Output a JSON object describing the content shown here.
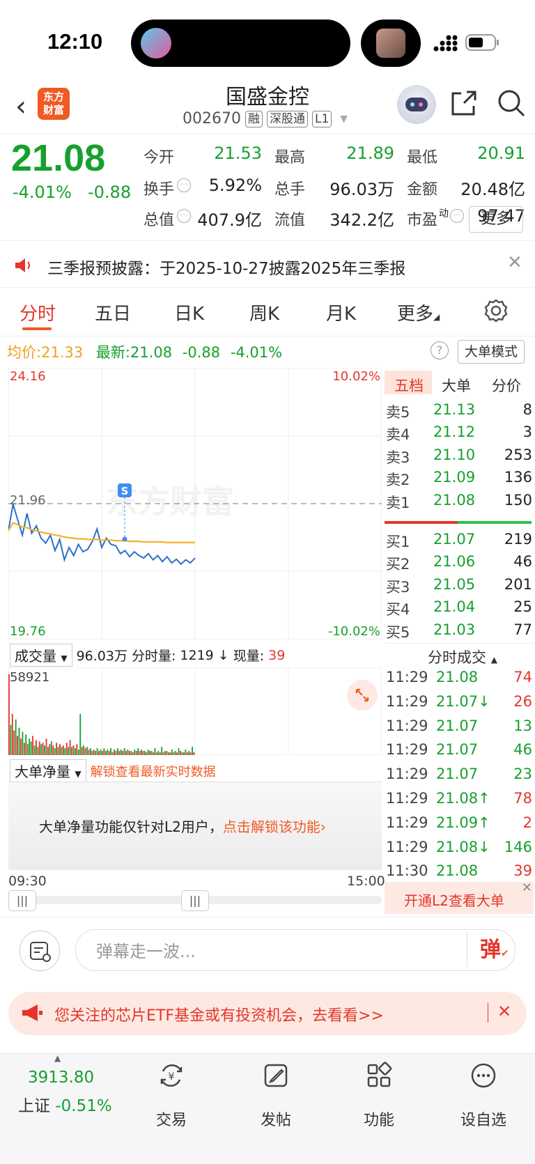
{
  "status": {
    "time": "12:10"
  },
  "header": {
    "logo_line1": "东方",
    "logo_line2": "财富",
    "title": "国盛金控",
    "code": "002670",
    "tags": [
      "融",
      "深股通",
      "L1"
    ]
  },
  "quote": {
    "price": "21.08",
    "pct": "-4.01%",
    "change": "-0.88",
    "fields": [
      {
        "label": "今开",
        "value": "21.53",
        "color": "green"
      },
      {
        "label": "最高",
        "value": "21.89",
        "color": "green"
      },
      {
        "label": "最低",
        "value": "20.91",
        "color": "green"
      },
      {
        "label": "换手",
        "value": "5.92%",
        "color": "dark"
      },
      {
        "label": "总手",
        "value": "96.03万",
        "color": "dark"
      },
      {
        "label": "金额",
        "value": "20.48亿",
        "color": "dark"
      },
      {
        "label": "总值",
        "value": "407.9亿",
        "color": "dark"
      },
      {
        "label": "流值",
        "value": "342.2亿",
        "color": "dark"
      },
      {
        "label": "市盈",
        "label_sup": "动",
        "value": "97.47",
        "color": "dark"
      }
    ],
    "more_label": "更多"
  },
  "notice": {
    "text": "三季报预披露：于2025-10-27披露2025年三季报"
  },
  "tabs": [
    "分时",
    "五日",
    "日K",
    "周K",
    "月K",
    "更多"
  ],
  "avg_row": {
    "avg_label": "均价:",
    "avg_value": "21.33",
    "latest_label": "最新:",
    "latest_value": "21.08",
    "latest_change": "-0.88",
    "latest_pct": "-4.01%",
    "mode_btn": "大单模式"
  },
  "chart_labels": {
    "y_top": "24.16",
    "y_mid": "21.96",
    "y_bottom": "19.76",
    "pct_top": "10.02%",
    "pct_bottom": "-10.02%",
    "watermark": "东方财富",
    "marker": "S",
    "x_start": "09:30",
    "x_end": "15:00"
  },
  "colors": {
    "up": "#e5352b",
    "down": "#16a02e",
    "price_line": "#2b6fc9",
    "avg_line": "#f5b02a",
    "accent": "#f05a24"
  },
  "chart_data": {
    "type": "line",
    "title": "",
    "xlabel": "",
    "ylabel": "",
    "ylim": [
      19.76,
      24.16
    ],
    "reference": 21.96,
    "x_range": [
      "09:30",
      "15:00"
    ],
    "x": [
      "09:30",
      "09:33",
      "09:36",
      "09:39",
      "09:42",
      "09:45",
      "09:48",
      "09:51",
      "09:54",
      "09:57",
      "10:00",
      "10:03",
      "10:06",
      "10:09",
      "10:12",
      "10:15",
      "10:18",
      "10:21",
      "10:24",
      "10:27",
      "10:30",
      "10:33",
      "10:36",
      "10:39",
      "10:42",
      "10:45",
      "10:48",
      "10:51",
      "10:54",
      "10:57",
      "11:00",
      "11:03",
      "11:06",
      "11:09",
      "11:12",
      "11:15",
      "11:18",
      "11:21",
      "11:24",
      "11:27",
      "11:30"
    ],
    "series": [
      {
        "values": [
          21.52,
          21.95,
          21.7,
          21.45,
          21.8,
          21.48,
          21.6,
          21.4,
          21.32,
          21.45,
          21.2,
          21.38,
          21.05,
          21.25,
          21.12,
          21.3,
          21.18,
          21.22,
          21.35,
          21.55,
          21.25,
          21.4,
          21.3,
          21.28,
          21.15,
          21.2,
          21.1,
          21.18,
          21.12,
          21.08,
          21.15,
          21.05,
          21.12,
          21.02,
          21.1,
          21.0,
          21.06,
          20.98,
          21.05,
          21.0,
          21.08
        ]
      },
      {
        "values": [
          21.52,
          21.65,
          21.62,
          21.58,
          21.57,
          21.54,
          21.52,
          21.5,
          21.48,
          21.47,
          21.45,
          21.44,
          21.42,
          21.41,
          21.4,
          21.39,
          21.39,
          21.38,
          21.38,
          21.38,
          21.37,
          21.37,
          21.37,
          21.36,
          21.36,
          21.36,
          21.35,
          21.35,
          21.35,
          21.34,
          21.34,
          21.34,
          21.34,
          21.34,
          21.33,
          21.33,
          21.33,
          21.33,
          21.33,
          21.33,
          21.33
        ]
      }
    ],
    "volume": {
      "max_label": "58921",
      "bars": [
        58921,
        22000,
        30000,
        18000,
        26000,
        14000,
        20000,
        12000,
        17000,
        9000,
        15000,
        8000,
        12000,
        10000,
        14000,
        7000,
        11000,
        6000,
        10000,
        8000,
        9000,
        7000,
        12000,
        6000,
        8000,
        10000,
        7000,
        5000,
        9000,
        6000,
        8000,
        6000,
        7000,
        5000,
        9000,
        6000,
        11000,
        6000,
        7000,
        5000,
        8000,
        4000,
        30000,
        6000,
        7000,
        5000,
        6000,
        4000,
        5000,
        3000,
        4000,
        3000,
        5000,
        3000,
        4000,
        3000,
        5000,
        3000,
        4000,
        3000,
        5000,
        2000,
        4000,
        3000,
        5000,
        3000,
        4000,
        3000,
        5000,
        3000,
        4000,
        3000,
        3000,
        2000,
        4000,
        3000,
        5000,
        3000,
        4000,
        3000,
        3000,
        2000,
        4000,
        3000,
        3000,
        2000,
        5000,
        2000,
        3000,
        2000,
        6000,
        2000,
        3000,
        3000,
        2000,
        2000,
        4000,
        2000,
        3000,
        2000,
        5000,
        3000,
        2000,
        2000,
        4000,
        2000,
        3000,
        2000,
        6000,
        2000
      ],
      "directions": [
        "u",
        "d",
        "u",
        "u",
        "d",
        "u",
        "d",
        "u",
        "d",
        "u",
        "d",
        "u",
        "d",
        "d",
        "u",
        "d",
        "u",
        "d",
        "u",
        "d",
        "u",
        "d",
        "u",
        "d",
        "u",
        "d",
        "u",
        "d",
        "u",
        "d",
        "u",
        "d",
        "u",
        "d",
        "u",
        "d",
        "u",
        "d",
        "u",
        "d",
        "u",
        "d",
        "d",
        "u",
        "d",
        "u",
        "d",
        "u",
        "d",
        "u",
        "d",
        "u",
        "d",
        "u",
        "d",
        "u",
        "d",
        "u",
        "d",
        "u",
        "d",
        "u",
        "d",
        "u",
        "d",
        "u",
        "d",
        "u",
        "d",
        "u",
        "d",
        "u",
        "d",
        "u",
        "d",
        "u",
        "d",
        "u",
        "d",
        "u",
        "d",
        "u",
        "d",
        "u",
        "d",
        "u",
        "d",
        "u",
        "d",
        "u",
        "d",
        "u",
        "d",
        "u",
        "d",
        "u",
        "d",
        "u",
        "d",
        "u",
        "d",
        "u",
        "d",
        "u",
        "d",
        "u",
        "d",
        "u",
        "d",
        "u"
      ]
    }
  },
  "order_book": {
    "tabs": [
      "五档",
      "大单",
      "分价"
    ],
    "asks": [
      {
        "label": "卖5",
        "price": "21.13",
        "vol": "8"
      },
      {
        "label": "卖4",
        "price": "21.12",
        "vol": "3"
      },
      {
        "label": "卖3",
        "price": "21.10",
        "vol": "253"
      },
      {
        "label": "卖2",
        "price": "21.09",
        "vol": "136"
      },
      {
        "label": "卖1",
        "price": "21.08",
        "vol": "150"
      }
    ],
    "bids": [
      {
        "label": "买1",
        "price": "21.07",
        "vol": "219"
      },
      {
        "label": "买2",
        "price": "21.06",
        "vol": "46"
      },
      {
        "label": "买3",
        "price": "21.05",
        "vol": "201"
      },
      {
        "label": "买4",
        "price": "21.04",
        "vol": "25"
      },
      {
        "label": "买5",
        "price": "21.03",
        "vol": "77"
      }
    ],
    "ticks_title": "分时成交",
    "ticks": [
      {
        "time": "11:29",
        "price": "21.08",
        "vol": "74",
        "dir": "u"
      },
      {
        "time": "11:29",
        "price": "21.07↓",
        "vol": "26",
        "dir": "u"
      },
      {
        "time": "11:29",
        "price": "21.07",
        "vol": "13",
        "dir": "d"
      },
      {
        "time": "11:29",
        "price": "21.07",
        "vol": "46",
        "dir": "d"
      },
      {
        "time": "11:29",
        "price": "21.07",
        "vol": "23",
        "dir": "d"
      },
      {
        "time": "11:29",
        "price": "21.08↑",
        "vol": "78",
        "dir": "u"
      },
      {
        "time": "11:29",
        "price": "21.09↑",
        "vol": "2",
        "dir": "u"
      },
      {
        "time": "11:29",
        "price": "21.08↓",
        "vol": "146",
        "dir": "d"
      },
      {
        "time": "11:30",
        "price": "21.08",
        "vol": "39",
        "dir": "u"
      }
    ],
    "l2_btn": "开通L2查看大单"
  },
  "volume_header": {
    "select": "成交量",
    "total": "96.03万",
    "period_label": "分时量:",
    "period_value": "1219 ↓",
    "now_label": "现量:",
    "now_value": "39"
  },
  "bigorder": {
    "select": "大单净量",
    "unlock_text": "解锁查看最新实时数据",
    "panel_text": "大单净量功能仅针对L2用户，",
    "panel_link": "点击解锁该功能›"
  },
  "comment": {
    "placeholder": "弹幕走一波...",
    "btn": "弹"
  },
  "promo": {
    "text": "您关注的芯片ETF基金或有投资机会，去看看>>"
  },
  "bottom_nav": {
    "index_value": "3913.80",
    "index_name": "上证",
    "index_pct": "-0.51%",
    "items": [
      {
        "label": "交易",
        "icon": "yen-exchange-icon"
      },
      {
        "label": "发帖",
        "icon": "edit-icon"
      },
      {
        "label": "功能",
        "icon": "grid-icon"
      },
      {
        "label": "设自选",
        "icon": "more-circle-icon"
      }
    ]
  }
}
